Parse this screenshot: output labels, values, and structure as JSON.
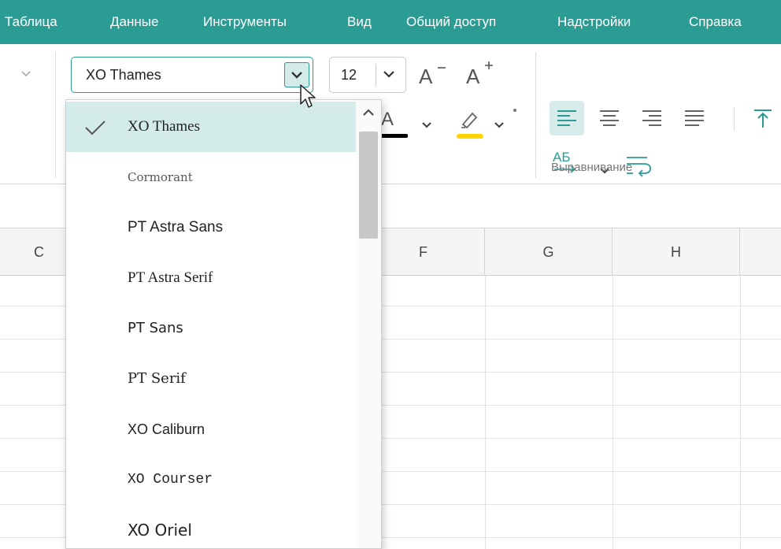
{
  "menubar": {
    "items": [
      "Таблица",
      "Данные",
      "Инструменты",
      "Вид",
      "Общий доступ",
      "Надстройки",
      "Справка"
    ]
  },
  "toolbar": {
    "font_name": "XO Thames",
    "font_size": "12",
    "decrease_font_label": "A",
    "increase_font_label": "A",
    "font_color_label": "A",
    "text_direction_label": "АБ",
    "alignment_group_label": "Выравнивание"
  },
  "columns": [
    "C",
    "F",
    "G",
    "H"
  ],
  "font_dropdown": {
    "selected": "XO Thames",
    "items": [
      "XO Thames",
      "Cormorant",
      "PT Astra Sans",
      "PT Astra Serif",
      "PT Sans",
      "PT Serif",
      "XO Caliburn",
      "XO Courser",
      "XO Oriel"
    ]
  },
  "colors": {
    "accent": "#2a9c93",
    "selected_bg": "#d3ecea",
    "highlight": "#ffd400",
    "font_color_bar": "#000000"
  }
}
